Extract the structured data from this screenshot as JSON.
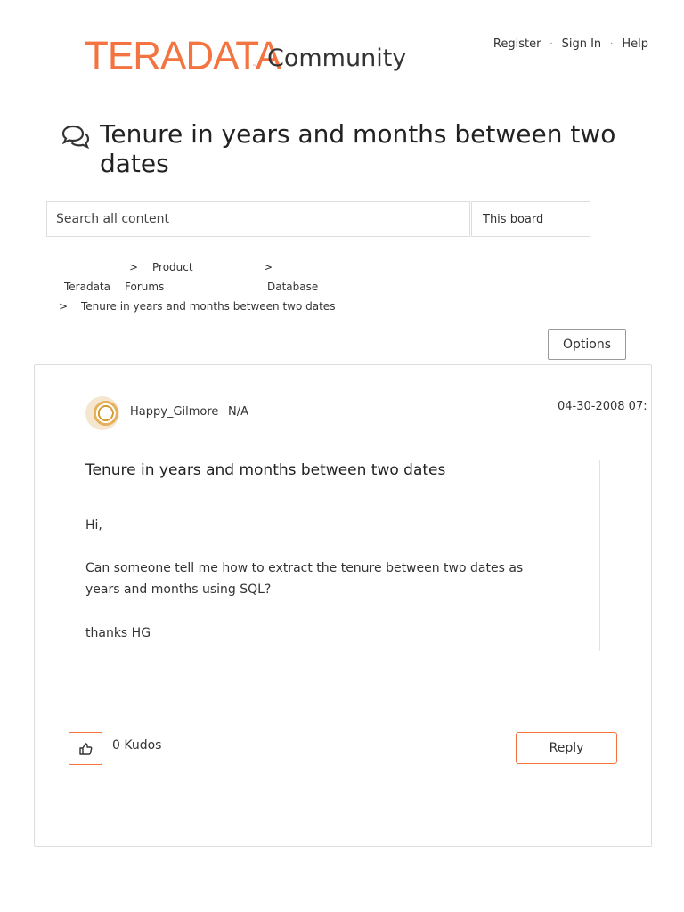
{
  "header": {
    "logo_text": "TERADATA",
    "logo_sub": "Community",
    "links": [
      "Register",
      "Sign In",
      "Help"
    ]
  },
  "page": {
    "title": "Tenure in years and months between two dates"
  },
  "search": {
    "placeholder": "Search all content",
    "scope": "This board"
  },
  "breadcrumb": {
    "items": [
      "Teradata",
      "Product Forums",
      "Database",
      "Tenure in years and months between two dates"
    ],
    "separator": ">"
  },
  "options_label": "Options",
  "post": {
    "author": "Happy_Gilmore",
    "rank": "N/A",
    "date": "04-30-2008 07:",
    "subject": "Tenure in years and months between two dates",
    "body": {
      "greeting": "Hi,",
      "question_line1": "Can someone tell me how to extract the tenure between two dates as",
      "question_line2": "years and months using SQL?",
      "signoff": "thanks HG"
    },
    "kudos_count": "0 Kudos",
    "reply_label": "Reply"
  },
  "colors": {
    "brand": "#f37440",
    "border": "#dddddd"
  }
}
